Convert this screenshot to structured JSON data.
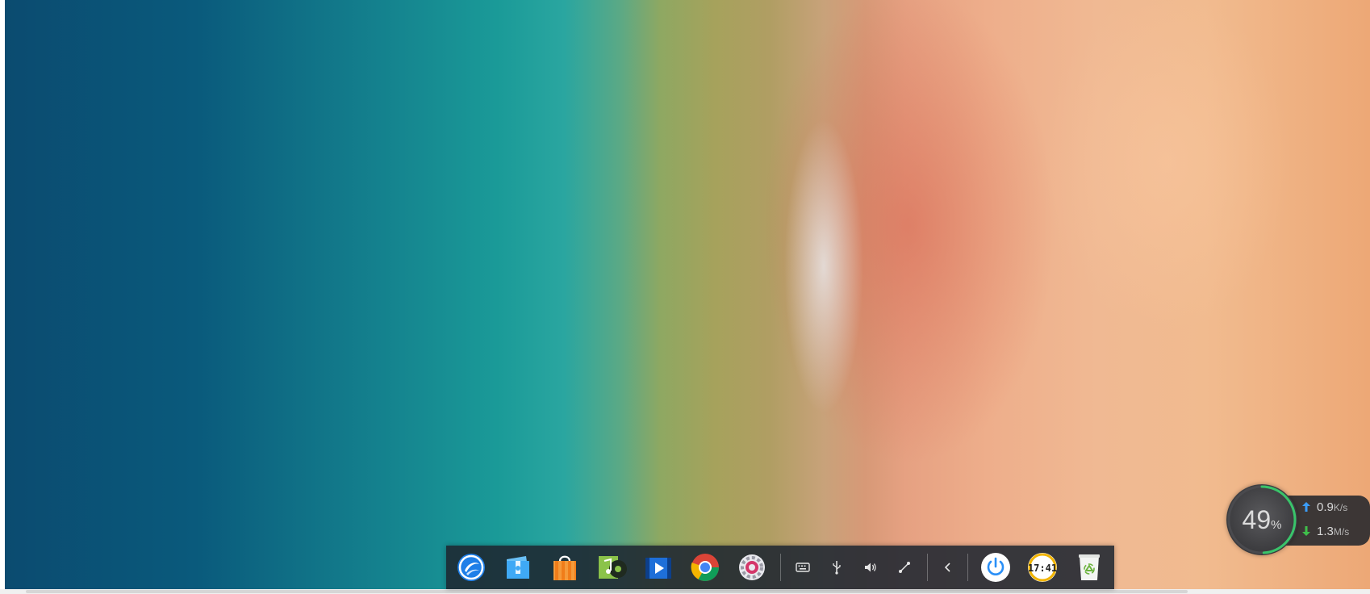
{
  "desktop": {
    "wallpaper": "aerial-beach"
  },
  "dock": {
    "apps": [
      {
        "name": "launcher",
        "icon": "deepin-launcher-icon",
        "color": "#2a8ff7"
      },
      {
        "name": "file-manager",
        "icon": "folder-icon",
        "color": "#3fa9f5"
      },
      {
        "name": "app-store",
        "icon": "shopping-bag-icon",
        "color": "#f5862b"
      },
      {
        "name": "music",
        "icon": "music-icon",
        "color": "#8bc34a"
      },
      {
        "name": "video",
        "icon": "video-player-icon",
        "color": "#1e88e5"
      },
      {
        "name": "chrome",
        "icon": "chrome-icon",
        "color": "#db4437"
      },
      {
        "name": "settings",
        "icon": "gear-icon",
        "color": "#ffffff"
      }
    ],
    "tray": [
      {
        "name": "keyboard",
        "icon": "keyboard-icon"
      },
      {
        "name": "usb",
        "icon": "usb-icon"
      },
      {
        "name": "volume",
        "icon": "volume-icon"
      },
      {
        "name": "network",
        "icon": "network-icon"
      },
      {
        "name": "expand",
        "icon": "chevron-left-icon"
      }
    ],
    "power": {
      "icon": "power-icon",
      "color": "#2a8ff7"
    },
    "clock": {
      "text": "17:41",
      "ring_color": "#f2b400"
    },
    "trash": {
      "icon": "trash-icon",
      "color": "#8bc34a"
    }
  },
  "monitor": {
    "cpu_value": "49",
    "cpu_unit": "%",
    "cpu_fraction": 0.49,
    "upload_value": "0.9",
    "upload_unit": "K/s",
    "download_value": "1.3",
    "download_unit": "M/s",
    "up_color": "#3b9cf6",
    "down_color": "#3fbf4a",
    "ring_color": "#39c46a"
  }
}
